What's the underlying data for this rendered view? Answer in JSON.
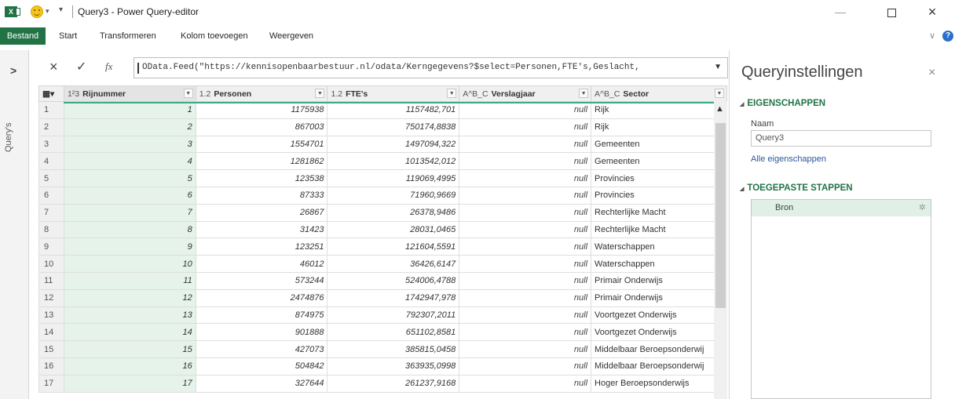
{
  "window": {
    "title": "Query3 - Power Query-editor",
    "min": "—",
    "close": "×"
  },
  "ribbon": {
    "tabs": [
      "Bestand",
      "Start",
      "Transformeren",
      "Kolom toevoegen",
      "Weergeven"
    ],
    "help": "?"
  },
  "leftnav": {
    "label": "Query's",
    "expand": ">"
  },
  "formula": {
    "cancel": "×",
    "confirm": "✓",
    "fx": "fx",
    "text": "OData.Feed(\"https://kennisopenbaarbestuur.nl/odata/Kerngegevens?$select=Personen,FTE's,Geslacht,"
  },
  "grid": {
    "columns": [
      {
        "type": "1²3",
        "name": "Rijnummer"
      },
      {
        "type": "1.2",
        "name": "Personen"
      },
      {
        "type": "1.2",
        "name": "FTE's"
      },
      {
        "type": "A^B_C",
        "name": "Verslagjaar"
      },
      {
        "type": "A^B_C",
        "name": "Sector"
      }
    ],
    "rows": [
      [
        "1",
        "1",
        "1175938",
        "1157482,701",
        "null",
        "Rijk"
      ],
      [
        "2",
        "2",
        "867003",
        "750174,8838",
        "null",
        "Rijk"
      ],
      [
        "3",
        "3",
        "1554701",
        "1497094,322",
        "null",
        "Gemeenten"
      ],
      [
        "4",
        "4",
        "1281862",
        "1013542,012",
        "null",
        "Gemeenten"
      ],
      [
        "5",
        "5",
        "123538",
        "119069,4995",
        "null",
        "Provincies"
      ],
      [
        "6",
        "6",
        "87333",
        "71960,9669",
        "null",
        "Provincies"
      ],
      [
        "7",
        "7",
        "26867",
        "26378,9486",
        "null",
        "Rechterlijke Macht"
      ],
      [
        "8",
        "8",
        "31423",
        "28031,0465",
        "null",
        "Rechterlijke Macht"
      ],
      [
        "9",
        "9",
        "123251",
        "121604,5591",
        "null",
        "Waterschappen"
      ],
      [
        "10",
        "10",
        "46012",
        "36426,6147",
        "null",
        "Waterschappen"
      ],
      [
        "11",
        "11",
        "573244",
        "524006,4788",
        "null",
        "Primair Onderwijs"
      ],
      [
        "12",
        "12",
        "2474876",
        "1742947,978",
        "null",
        "Primair Onderwijs"
      ],
      [
        "13",
        "13",
        "874975",
        "792307,2011",
        "null",
        "Voortgezet Onderwijs"
      ],
      [
        "14",
        "14",
        "901888",
        "651102,8581",
        "null",
        "Voortgezet Onderwijs"
      ],
      [
        "15",
        "15",
        "427073",
        "385815,0458",
        "null",
        "Middelbaar Beroepsonderwij"
      ],
      [
        "16",
        "16",
        "504842",
        "363935,0998",
        "null",
        "Middelbaar Beroepsonderwij"
      ],
      [
        "17",
        "17",
        "327644",
        "261237,9168",
        "null",
        "Hoger Beroepsonderwijs"
      ]
    ]
  },
  "pane": {
    "title": "Queryinstellingen",
    "close": "×",
    "properties_head": "EIGENSCHAPPEN",
    "name_label": "Naam",
    "name_value": "Query3",
    "all_props_link": "Alle eigenschappen",
    "steps_head": "TOEGEPASTE STAPPEN",
    "steps": [
      "Bron"
    ]
  },
  "colors": {
    "excel_green": "#217346",
    "selected_col": "#e5f3ea",
    "link": "#2b579a"
  }
}
